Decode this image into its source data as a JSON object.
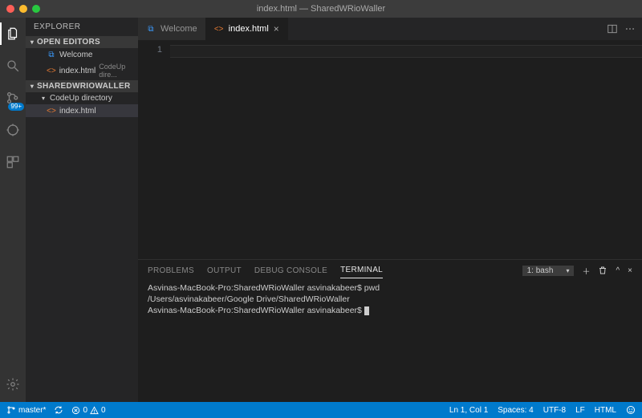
{
  "title": "index.html — SharedWRioWaller",
  "activitybar": {
    "badge": "99+"
  },
  "sidebar": {
    "title": "EXPLORER",
    "sections": {
      "open_editors": "OPEN EDITORS",
      "workspace": "SHAREDWRIOWALLER"
    },
    "items": {
      "welcome": "Welcome",
      "index_html": "index.html",
      "index_dim": "CodeUp dire...",
      "folder": "CodeUp directory",
      "file2": "index.html"
    }
  },
  "tabs": {
    "welcome": "Welcome",
    "index": "index.html"
  },
  "gutter": {
    "line1": "1"
  },
  "panel": {
    "problems": "PROBLEMS",
    "output": "OUTPUT",
    "debug": "DEBUG CONSOLE",
    "terminal": "TERMINAL",
    "select": "1: bash",
    "lines": [
      "Asvinas-MacBook-Pro:SharedWRioWaller asvinakabeer$ pwd",
      "/Users/asvinakabeer/Google Drive/SharedWRioWaller",
      "Asvinas-MacBook-Pro:SharedWRioWaller asvinakabeer$ "
    ]
  },
  "status": {
    "branch": "master*",
    "errors": "0",
    "warnings": "0",
    "lncol": "Ln 1, Col 1",
    "spaces": "Spaces: 4",
    "encoding": "UTF-8",
    "eol": "LF",
    "lang": "HTML"
  }
}
